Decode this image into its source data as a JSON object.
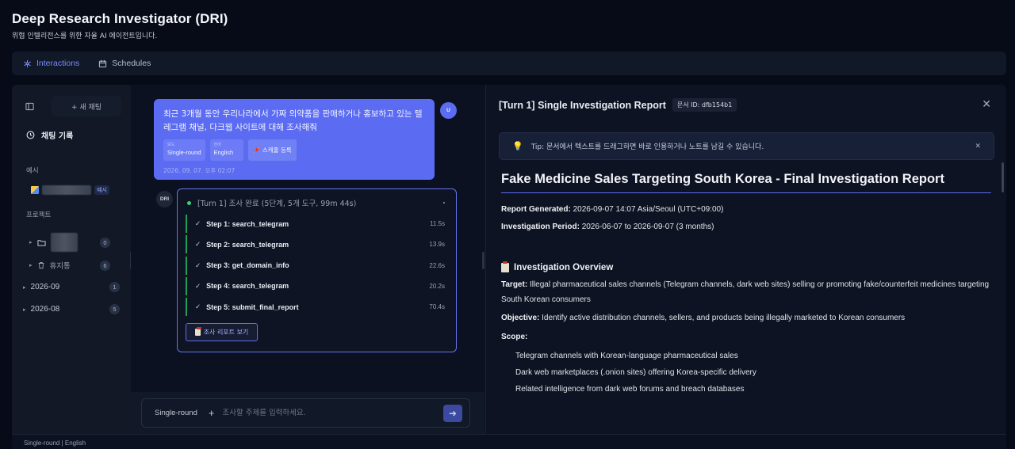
{
  "app": {
    "title": "Deep Research Investigator (DRI)",
    "subtitle": "위협 인텔리전스를 위한 자율 AI 에이전트입니다."
  },
  "tabs": [
    {
      "label": "Interactions",
      "active": true,
      "icon": "network-icon"
    },
    {
      "label": "Schedules",
      "active": false,
      "icon": "calendar-icon"
    }
  ],
  "sidebar": {
    "new_chat_label": "+ 새 채팅",
    "history_label": "채팅 기록",
    "example_section": "예시",
    "example_badge": "예시",
    "project_section": "프로젝트",
    "project_folder_count": "0",
    "trash_label": "휴지통",
    "trash_count": "6",
    "months": [
      {
        "label": "2026-09",
        "count": "1"
      },
      {
        "label": "2026-08",
        "count": "5"
      }
    ]
  },
  "chat": {
    "user_avatar": "U",
    "agent_avatar": "DRI",
    "user_message": "최근 3개월 동안 우리나라에서 가짜 의약품을 판매하거나 홍보하고 있는 텔레그램 채널, 다크웹 사이트에 대해 조사해줘",
    "chips": [
      {
        "key": "모드",
        "value": "Single-round"
      },
      {
        "key": "언어",
        "value": "English"
      }
    ],
    "schedule_button": "스케줄 등록",
    "timestamp": "2026. 09. 07. 오후 02:07",
    "agent_summary": "[Turn 1] 조사 완료 (5단계, 5개 도구, 99m 44s)",
    "steps": [
      {
        "label": "Step 1: search_telegram",
        "duration": "11.5s"
      },
      {
        "label": "Step 2: search_telegram",
        "duration": "13.9s"
      },
      {
        "label": "Step 3: get_domain_info",
        "duration": "22.6s"
      },
      {
        "label": "Step 4: search_telegram",
        "duration": "20.2s"
      },
      {
        "label": "Step 5: submit_final_report",
        "duration": "70.4s"
      }
    ],
    "report_button": "조사 리포트 보기",
    "composer": {
      "mode": "Single-round",
      "placeholder": "조사할 주제를 입력하세요."
    }
  },
  "report": {
    "header_title": "[Turn 1] Single Investigation Report",
    "doc_id": "문서 ID: dfb154b1",
    "tip": "Tip: 문서에서 텍스트를 드래그하면 바로 인용하거나 노트를 남길 수 있습니다.",
    "title": "Fake Medicine Sales Targeting South Korea - Final Investigation Report",
    "generated_label": "Report Generated:",
    "generated_value": "2026-09-07 14:07 Asia/Seoul (UTC+09:00)",
    "period_label": "Investigation Period:",
    "period_value": "2026-06-07 to 2026-09-07 (3 months)",
    "overview_heading": "Investigation Overview",
    "target_label": "Target:",
    "target_value": "Illegal pharmaceutical sales channels (Telegram channels, dark web sites) selling or promoting fake/counterfeit medicines targeting South Korean consumers",
    "objective_label": "Objective:",
    "objective_value": "Identify active distribution channels, sellers, and products being illegally marketed to Korean consumers",
    "scope_label": "Scope:",
    "scope_items": [
      "Telegram channels with Korean-language pharmaceutical sales",
      "Dark web marketplaces (.onion sites) offering Korea-specific delivery",
      "Related intelligence from dark web forums and breach databases"
    ]
  },
  "status_bar": "Single-round | English",
  "colors": {
    "accent": "#5b6cf2",
    "success": "#34d17a",
    "background": "#060b17"
  }
}
